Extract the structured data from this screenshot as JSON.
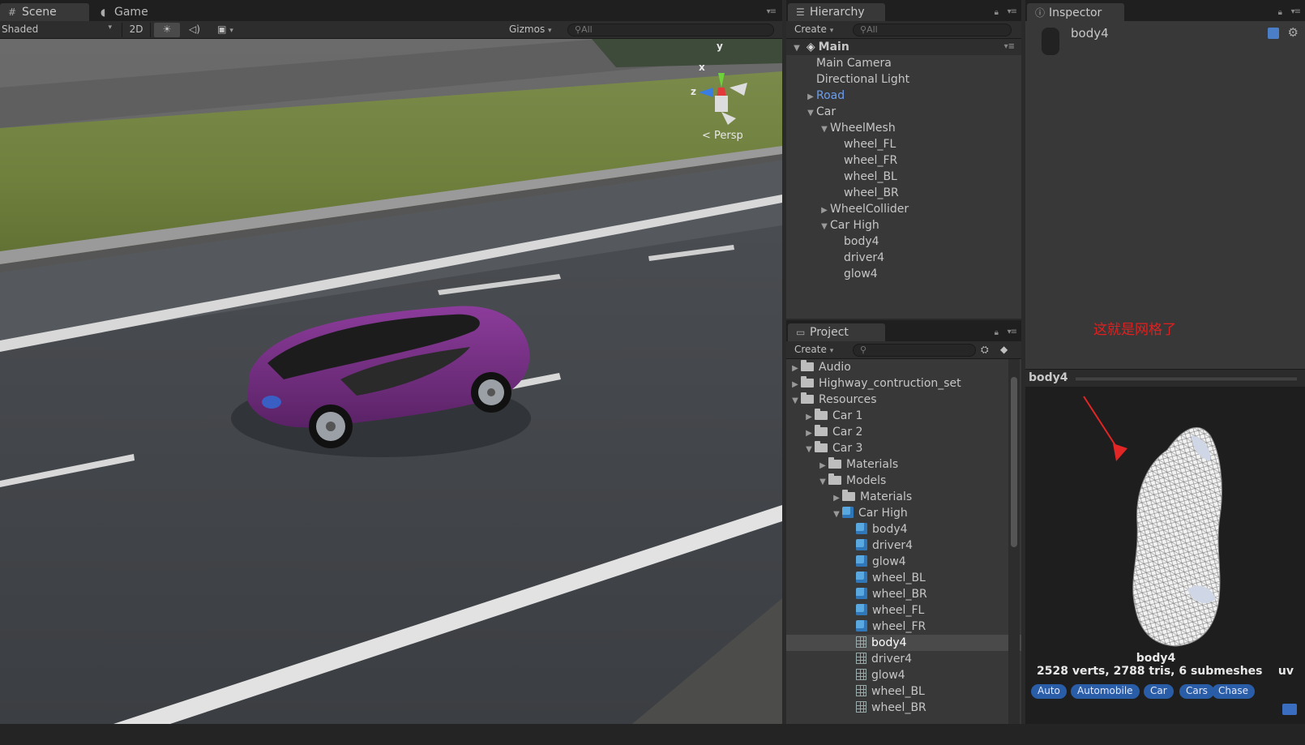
{
  "scene_panel": {
    "tabs": [
      {
        "label": "Scene"
      },
      {
        "label": "Game"
      }
    ],
    "toolbar": {
      "shading_mode": "Shaded",
      "btn_2d": "2D",
      "gizmos": "Gizmos",
      "search_placeholder": "All"
    },
    "gizmo_axes": {
      "y": "y",
      "x": "x",
      "z": "z"
    },
    "persp_label": "Persp"
  },
  "hierarchy": {
    "tab": "Hierarchy",
    "create": "Create",
    "search_placeholder": "All",
    "scene_name": "Main",
    "items": [
      {
        "label": "Main Camera",
        "depth": 1,
        "arrow": ""
      },
      {
        "label": "Directional Light",
        "depth": 1,
        "arrow": ""
      },
      {
        "label": "Road",
        "depth": 1,
        "arrow": "▶",
        "highlight": true
      },
      {
        "label": "Car",
        "depth": 1,
        "arrow": "▼"
      },
      {
        "label": "WheelMesh",
        "depth": 2,
        "arrow": "▼"
      },
      {
        "label": "wheel_FL",
        "depth": 3,
        "arrow": ""
      },
      {
        "label": "wheel_FR",
        "depth": 3,
        "arrow": ""
      },
      {
        "label": "wheel_BL",
        "depth": 3,
        "arrow": ""
      },
      {
        "label": "wheel_BR",
        "depth": 3,
        "arrow": ""
      },
      {
        "label": "WheelCollider",
        "depth": 2,
        "arrow": "▶"
      },
      {
        "label": "Car High",
        "depth": 2,
        "arrow": "▼"
      },
      {
        "label": "body4",
        "depth": 3,
        "arrow": ""
      },
      {
        "label": "driver4",
        "depth": 3,
        "arrow": ""
      },
      {
        "label": "glow4",
        "depth": 3,
        "arrow": ""
      }
    ]
  },
  "project": {
    "tab": "Project",
    "create": "Create",
    "items": [
      {
        "label": "Audio",
        "depth": 0,
        "arrow": "▶",
        "icon": "folder"
      },
      {
        "label": "Highway_contruction_set",
        "depth": 0,
        "arrow": "▶",
        "icon": "folder"
      },
      {
        "label": "Resources",
        "depth": 0,
        "arrow": "▼",
        "icon": "folder"
      },
      {
        "label": "Car 1",
        "depth": 1,
        "arrow": "▶",
        "icon": "folder"
      },
      {
        "label": "Car 2",
        "depth": 1,
        "arrow": "▶",
        "icon": "folder"
      },
      {
        "label": "Car 3",
        "depth": 1,
        "arrow": "▼",
        "icon": "folder"
      },
      {
        "label": "Materials",
        "depth": 2,
        "arrow": "▶",
        "icon": "folder"
      },
      {
        "label": "Models",
        "depth": 2,
        "arrow": "▼",
        "icon": "folder"
      },
      {
        "label": "Materials",
        "depth": 3,
        "arrow": "▶",
        "icon": "folder"
      },
      {
        "label": "Car High",
        "depth": 3,
        "arrow": "▼",
        "icon": "prefab"
      },
      {
        "label": "body4",
        "depth": 4,
        "arrow": "",
        "icon": "prefab"
      },
      {
        "label": "driver4",
        "depth": 4,
        "arrow": "",
        "icon": "prefab"
      },
      {
        "label": "glow4",
        "depth": 4,
        "arrow": "",
        "icon": "prefab"
      },
      {
        "label": "wheel_BL",
        "depth": 4,
        "arrow": "",
        "icon": "prefab"
      },
      {
        "label": "wheel_BR",
        "depth": 4,
        "arrow": "",
        "icon": "prefab"
      },
      {
        "label": "wheel_FL",
        "depth": 4,
        "arrow": "",
        "icon": "prefab"
      },
      {
        "label": "wheel_FR",
        "depth": 4,
        "arrow": "",
        "icon": "prefab"
      },
      {
        "label": "body4",
        "depth": 4,
        "arrow": "",
        "icon": "mesh",
        "selected": true
      },
      {
        "label": "driver4",
        "depth": 4,
        "arrow": "",
        "icon": "mesh"
      },
      {
        "label": "glow4",
        "depth": 4,
        "arrow": "",
        "icon": "mesh"
      },
      {
        "label": "wheel_BL",
        "depth": 4,
        "arrow": "",
        "icon": "mesh"
      },
      {
        "label": "wheel_BR",
        "depth": 4,
        "arrow": "",
        "icon": "mesh"
      }
    ]
  },
  "inspector": {
    "tab": "Inspector",
    "object_name": "body4",
    "annotation": "这就是网格了",
    "annotation_color": "#e02020",
    "preview_title": "body4",
    "preview_name": "body4",
    "preview_stats": "2528 verts, 2788 tris, 6 submeshes",
    "preview_uv": "uv",
    "tags": [
      "Auto",
      "Automobile",
      "Car",
      "Cars",
      "Chase"
    ]
  },
  "colors": {
    "car_body": "#6b2a78",
    "selection_blue": "#2a5da8"
  }
}
